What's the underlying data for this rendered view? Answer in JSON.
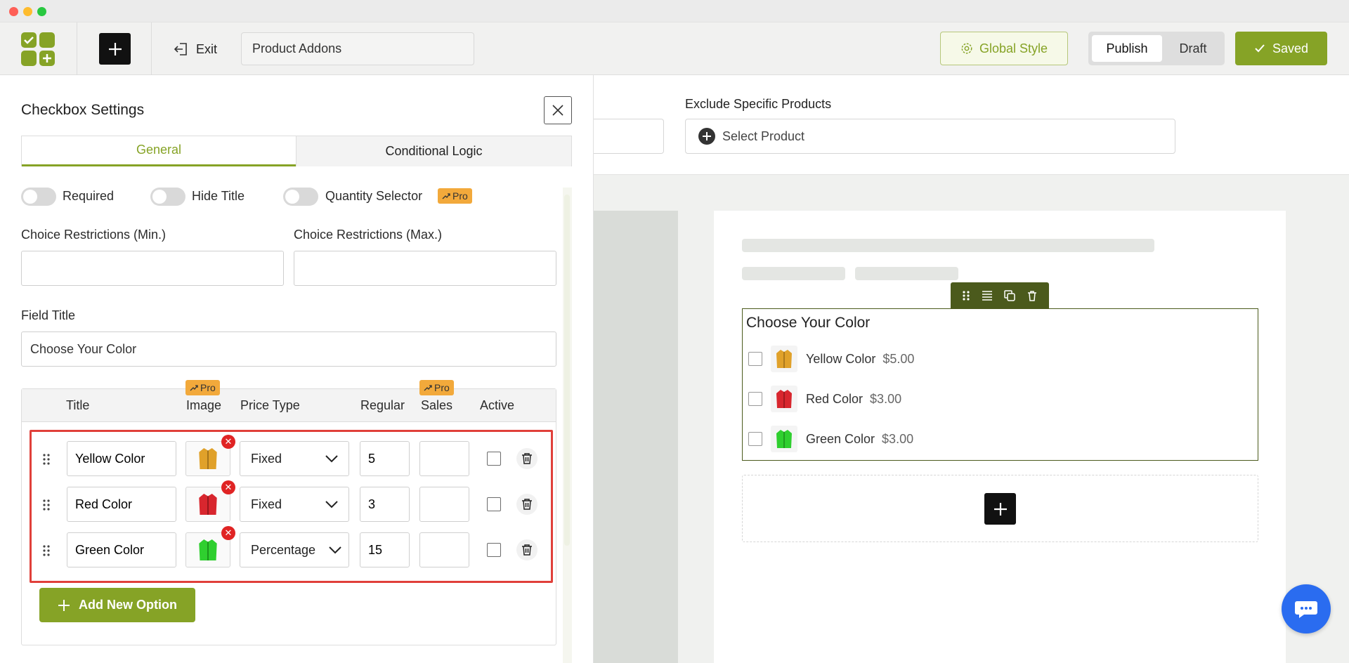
{
  "header": {
    "exit_label": "Exit",
    "title_value": "Product Addons",
    "global_style_label": "Global Style",
    "publish_label": "Publish",
    "draft_label": "Draft",
    "saved_label": "Saved"
  },
  "top_settings": {
    "exclude_label": "Exclude Specific Products",
    "select_product_label": "Select Product"
  },
  "panel": {
    "title": "Checkbox Settings",
    "tabs": [
      "General",
      "Conditional Logic"
    ],
    "active_tab": "General",
    "toggles": [
      {
        "label": "Required",
        "on": false
      },
      {
        "label": "Hide Title",
        "on": false
      },
      {
        "label": "Quantity Selector",
        "on": false
      }
    ],
    "pro_badge": "Pro",
    "min_label": "Choice Restrictions (Min.)",
    "min_value": "",
    "max_label": "Choice Restrictions (Max.)",
    "max_value": "",
    "field_title_label": "Field Title",
    "field_title_value": "Choose Your Color",
    "table": {
      "headers": [
        "Title",
        "Image",
        "Price Type",
        "Regular",
        "Sales",
        "Active"
      ],
      "rows": [
        {
          "title": "Yellow Color",
          "price_type": "Fixed",
          "regular": "5",
          "sales": "",
          "active": false,
          "color": "#e0a12a"
        },
        {
          "title": "Red Color",
          "price_type": "Fixed",
          "regular": "3",
          "sales": "",
          "active": false,
          "color": "#d8262e"
        },
        {
          "title": "Green Color",
          "price_type": "Percentage",
          "regular": "15",
          "sales": "",
          "active": false,
          "color": "#2fcf2f"
        }
      ]
    },
    "add_option_label": "Add New Option"
  },
  "preview": {
    "field_title": "Choose Your Color",
    "options": [
      {
        "label": "Yellow Color",
        "price": "$5.00",
        "color": "#e0a12a"
      },
      {
        "label": "Red Color",
        "price": "$3.00",
        "color": "#d8262e"
      },
      {
        "label": "Green Color",
        "price": "$3.00",
        "color": "#2fcf2f"
      }
    ]
  },
  "colors": {
    "accent": "#86a326",
    "highlight_border": "#e0403a",
    "toolbar_dark": "#4b5a1c",
    "chat_button": "#2a6cf0"
  },
  "icons": [
    "logo-icon",
    "plus-icon",
    "exit-icon",
    "gear-icon",
    "check-icon",
    "close-icon",
    "drag-handle-icon",
    "chevron-down-icon",
    "trash-icon",
    "chat-icon",
    "align-icon",
    "duplicate-icon",
    "trend-up-icon"
  ]
}
